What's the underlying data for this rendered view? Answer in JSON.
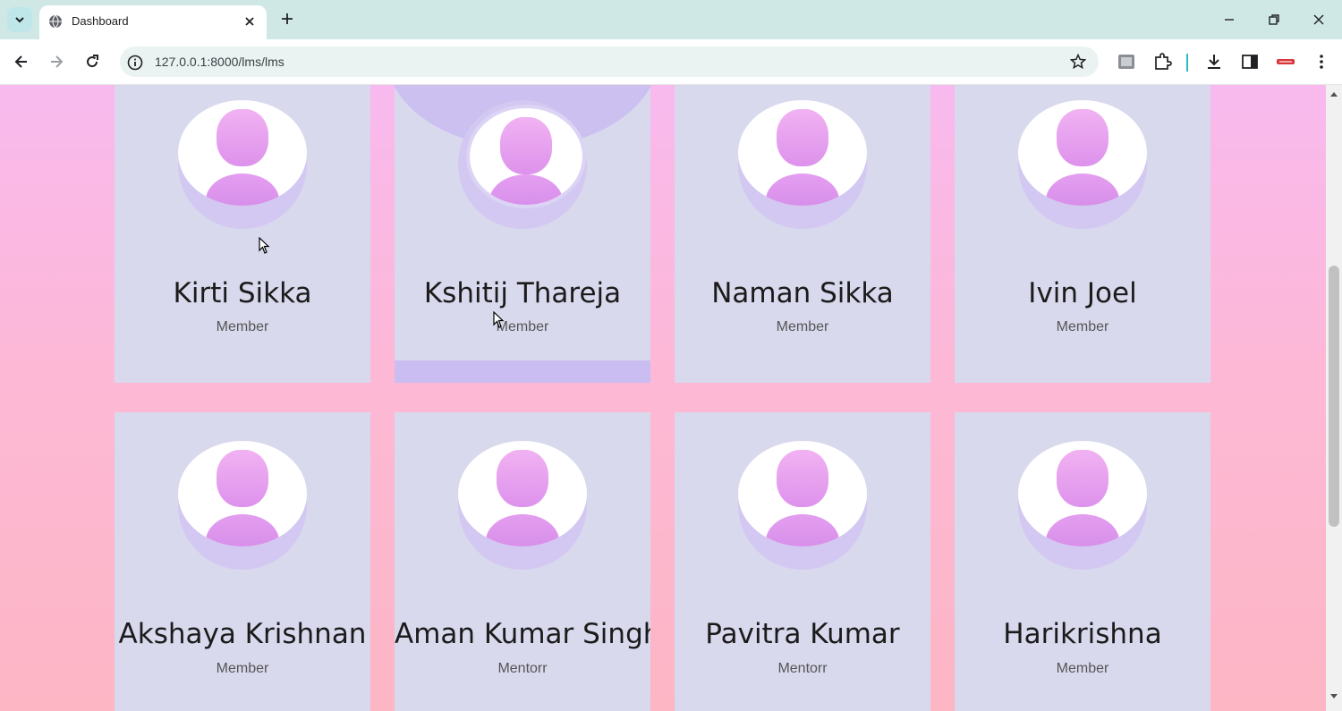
{
  "browser": {
    "tab_title": "Dashboard",
    "url": "127.0.0.1:8000/lms/lms"
  },
  "colors": {
    "page_gradient_top": "#f8b9ee",
    "page_gradient_bottom": "#fdb6c4",
    "card_bg": "#d9d9ee",
    "card_hover_accent": "#cbc0f0",
    "avatar_purple": "#dd92ec"
  },
  "members": [
    {
      "name": "Kirti Sikka",
      "role": "Member"
    },
    {
      "name": "Kshitij Thareja",
      "role": "Member"
    },
    {
      "name": "Naman Sikka",
      "role": "Member"
    },
    {
      "name": "Ivin Joel",
      "role": "Member"
    },
    {
      "name": "Akshaya Krishnan",
      "role": "Member"
    },
    {
      "name": "Aman Kumar Singh",
      "role": "Mentorr"
    },
    {
      "name": "Pavitra Kumar",
      "role": "Mentorr"
    },
    {
      "name": "Harikrishna",
      "role": "Member"
    }
  ]
}
